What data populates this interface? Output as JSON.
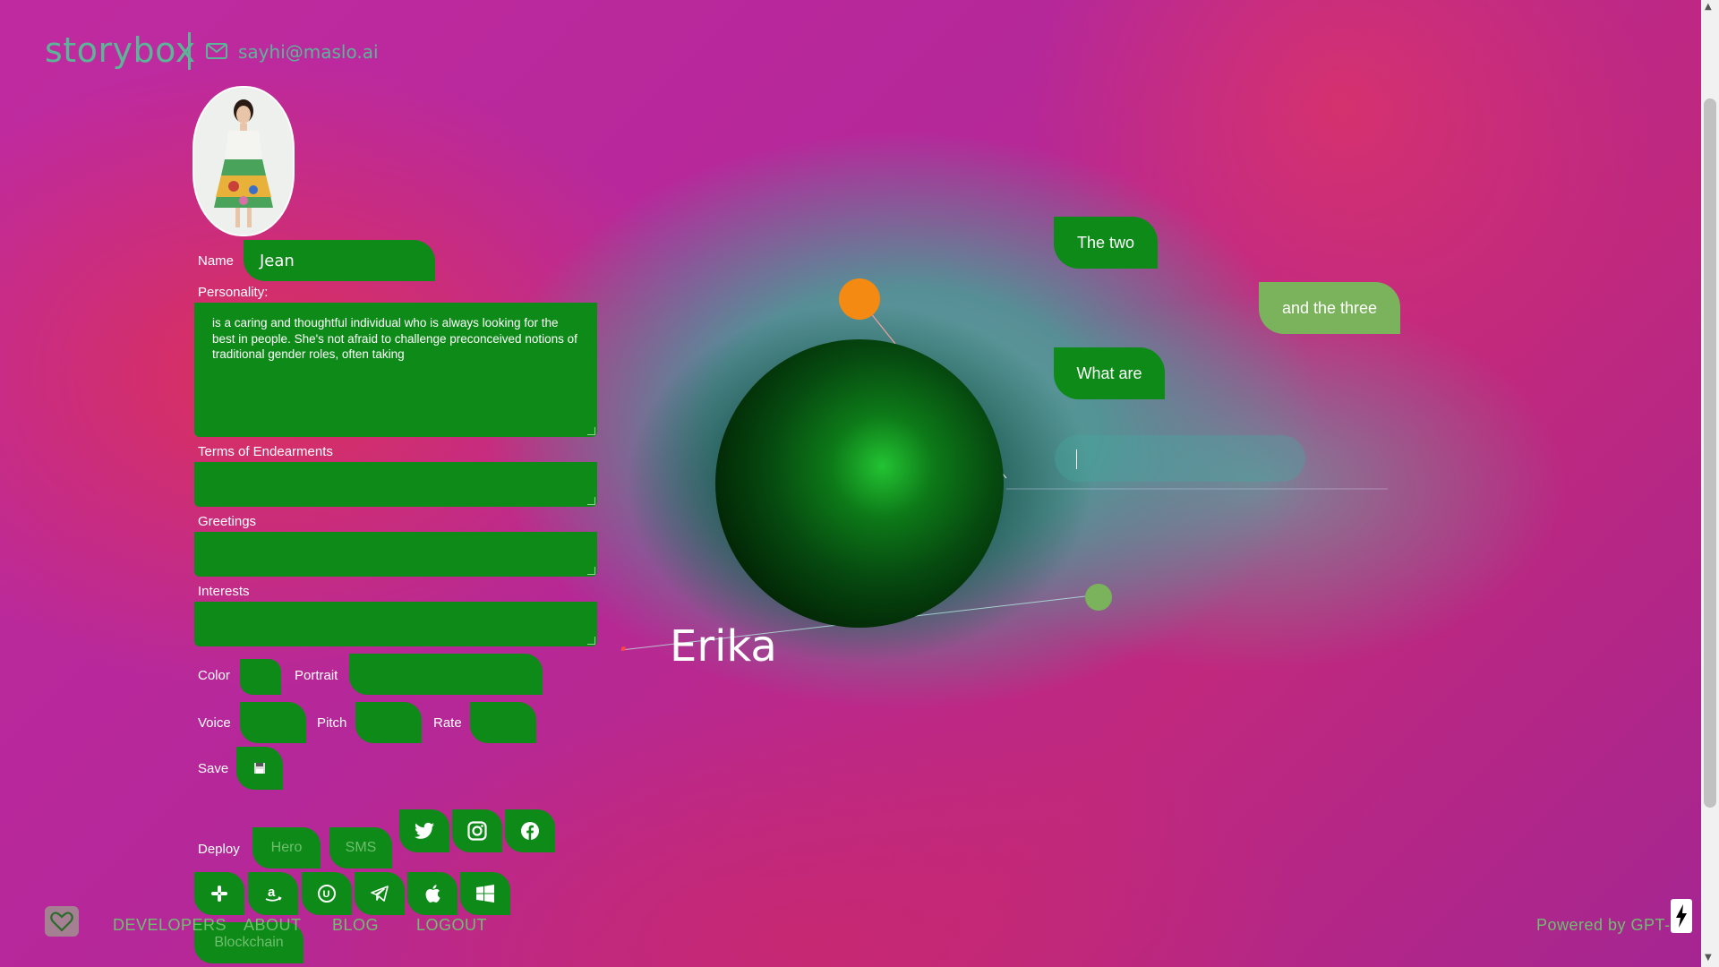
{
  "header": {
    "logo": "storybox",
    "email": "sayhi@maslo.ai"
  },
  "form": {
    "name_label": "Name",
    "name_value": "Jean",
    "personality_label": "Personality:",
    "personality_value": "is a caring and thoughtful individual who is always looking for the best in people. She's not afraid to challenge preconceived notions of traditional gender roles, often taking",
    "terms_label": "Terms of Endearments",
    "greetings_label": "Greetings",
    "interests_label": "Interests",
    "color_label": "Color",
    "portrait_label": "Portrait",
    "voice_label": "Voice",
    "pitch_label": "Pitch",
    "rate_label": "Rate",
    "save_label": "Save"
  },
  "deploy": {
    "label": "Deploy",
    "hero": "Hero",
    "sms": "SMS",
    "blockchain": "Blockchain",
    "icons": [
      "twitter-icon",
      "instagram-icon",
      "facebook-icon",
      "slack-icon",
      "amazon-icon",
      "unreal-icon",
      "telegram-icon",
      "apple-icon",
      "windows-icon"
    ]
  },
  "stage": {
    "character_name": "Erika",
    "bubbles": [
      "The two",
      "and the three",
      "What are"
    ],
    "orb_color": "#0d7a18",
    "accent_orange": "#f58a12"
  },
  "footer": {
    "links": [
      "DEVELOPERS",
      "ABOUT",
      "BLOG",
      "LOGOUT"
    ],
    "powered": "Powered by GPT-3"
  },
  "colors": {
    "brand": "#5db598",
    "field_green": "#0d8a17",
    "link_green": "#6fbf6f"
  }
}
